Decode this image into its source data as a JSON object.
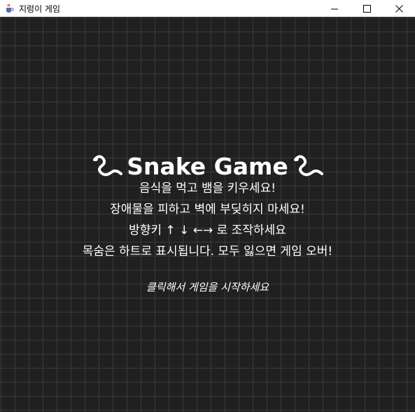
{
  "window": {
    "title": "지렁이 게임",
    "app_icon": "java-cup-icon",
    "controls": [
      "minimize-icon",
      "maximize-icon",
      "close-icon"
    ]
  },
  "colors": {
    "background": "#202020",
    "grid_line": "#3a3a3a",
    "text": "#ffffff"
  },
  "screen": {
    "title": "Snake Game",
    "title_icon": "snake-icon",
    "instructions": [
      "음식을 먹고 뱀을 키우세요!",
      "장애물을 피하고 벽에 부딪히지 마세요!",
      "방향키 ↑ ↓ ←→ 로 조작하세요",
      "목숨은 하트로 표시됩니다. 모두 잃으면 게임 오버!"
    ],
    "start_prompt": "클릭해서 게임을 시작하세요"
  }
}
